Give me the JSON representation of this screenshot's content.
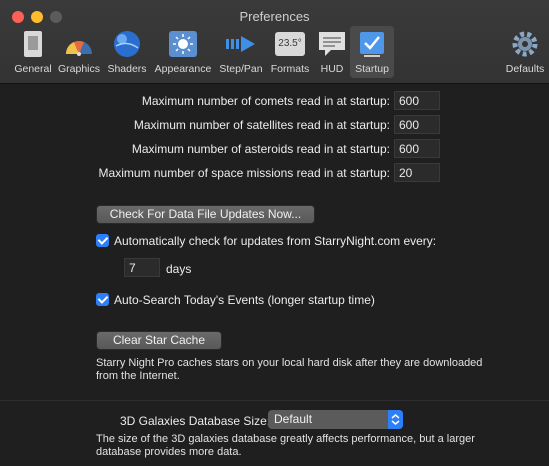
{
  "window": {
    "title": "Preferences"
  },
  "toolbar": {
    "items": [
      {
        "label": "General"
      },
      {
        "label": "Graphics"
      },
      {
        "label": "Shaders"
      },
      {
        "label": "Appearance"
      },
      {
        "label": "Step/Pan"
      },
      {
        "label": "Formats",
        "icon_text": "23.5°"
      },
      {
        "label": "HUD"
      },
      {
        "label": "Startup",
        "selected": true
      }
    ],
    "defaults_label": "Defaults"
  },
  "startup": {
    "comets": {
      "label": "Maximum number of comets read in at startup:",
      "value": "600"
    },
    "satellites": {
      "label": "Maximum number of satellites read in at startup:",
      "value": "600"
    },
    "asteroids": {
      "label": "Maximum number of asteroids read in at startup:",
      "value": "600"
    },
    "missions": {
      "label": "Maximum number of space missions read in at startup:",
      "value": "20"
    },
    "check_updates_button": "Check For Data File Updates Now...",
    "auto_check_label": "Automatically check for updates from StarryNight.com every:",
    "auto_check_checked": true,
    "days_value": "7",
    "days_label": "days",
    "auto_search_label": "Auto-Search Today's Events  (longer startup time)",
    "auto_search_checked": true,
    "clear_cache_button": "Clear Star Cache",
    "cache_note": "Starry Night Pro caches stars on your local hard disk after they are downloaded from the Internet.",
    "galaxies_label": "3D Galaxies Database Size:",
    "galaxies_value": "Default",
    "galaxies_note": "The size of the 3D galaxies database greatly affects performance, but a larger database provides more data."
  },
  "colors": {
    "accent": "#2d7ff9",
    "background": "#1f1f1f",
    "close": "#fe5f57",
    "minimize": "#febc2e"
  }
}
